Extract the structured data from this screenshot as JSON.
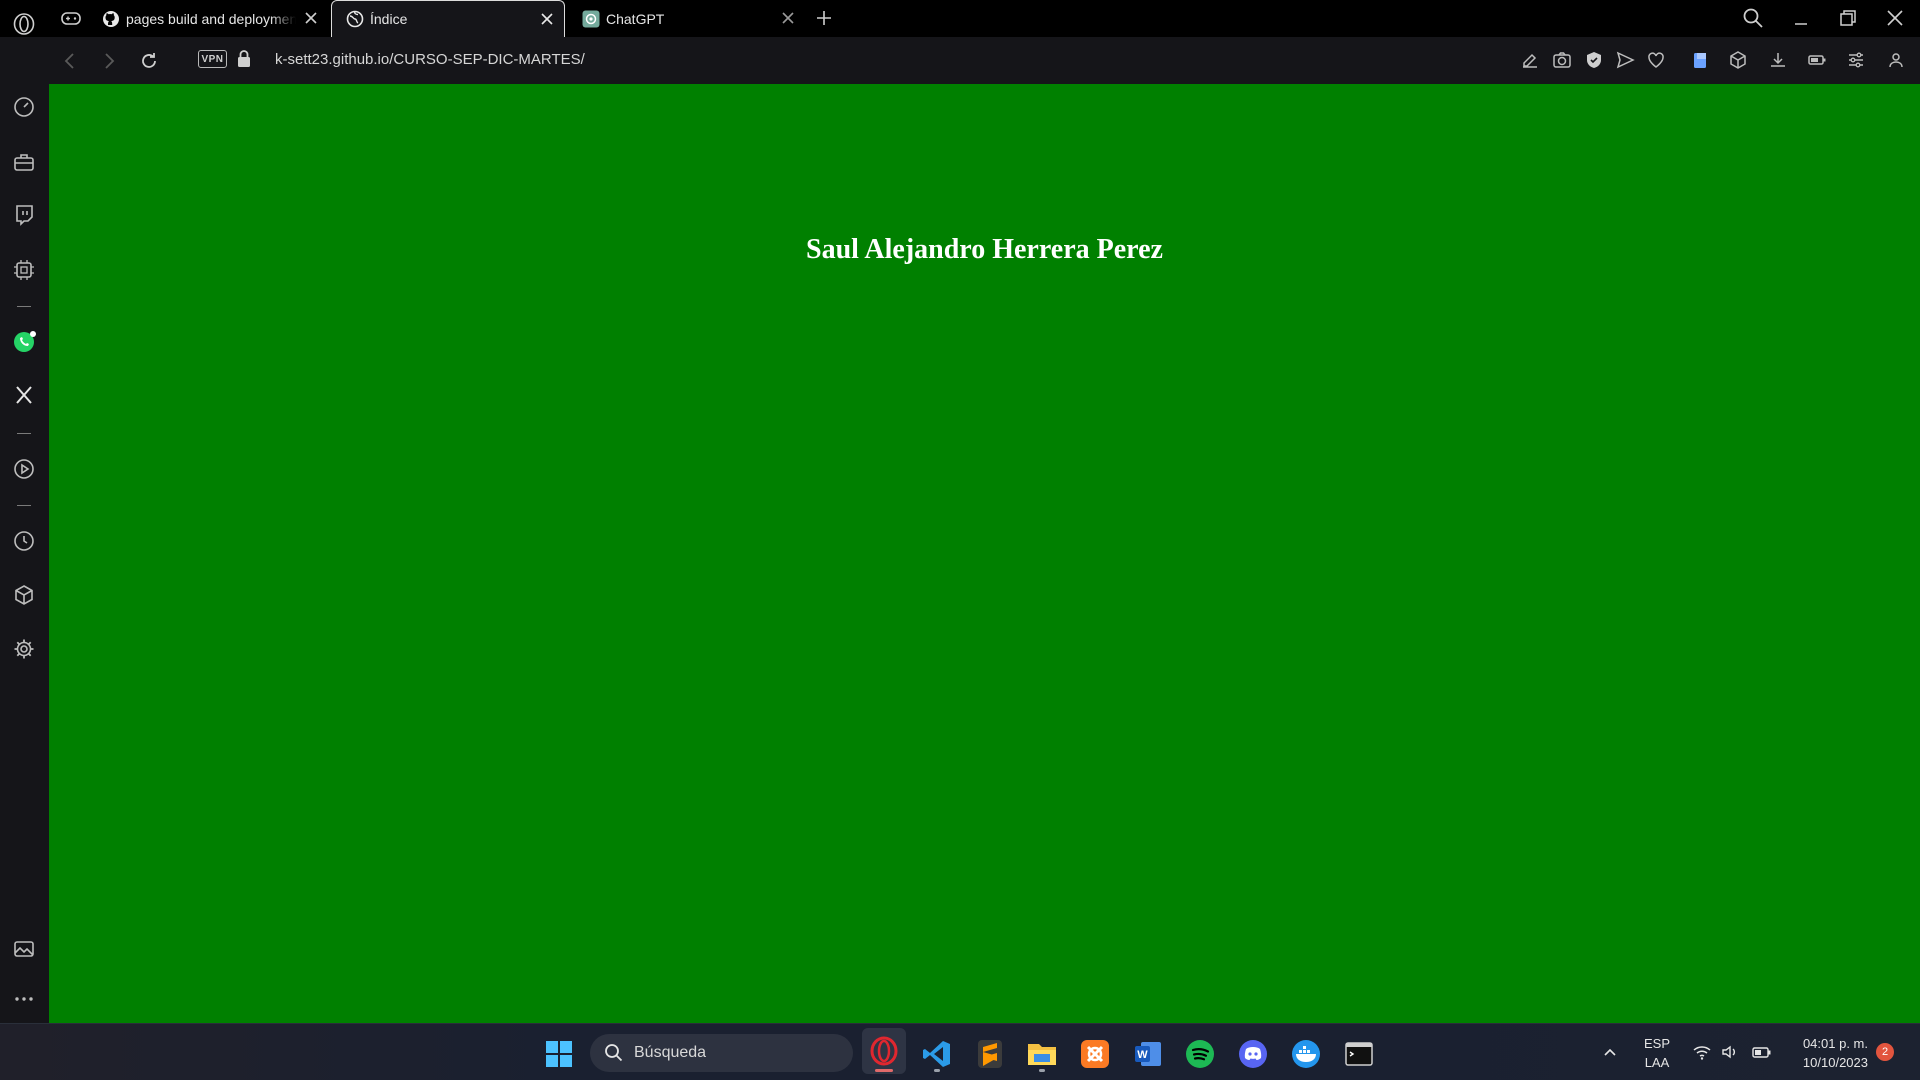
{
  "browser": {
    "tabs": [
      {
        "title": "pages build and deployment",
        "active": false
      },
      {
        "title": "Índice",
        "active": true
      },
      {
        "title": "ChatGPT",
        "active": false
      }
    ],
    "address": {
      "vpn_label": "VPN",
      "url": "k-sett23.github.io/CURSO-SEP-DIC-MARTES/"
    }
  },
  "page": {
    "heading": "Saul Alejandro Herrera Perez",
    "background_color": "#008000",
    "text_color": "#ffffff"
  },
  "sidebar": {
    "items": [
      "speed-dial-icon",
      "briefcase-icon",
      "twitch-icon",
      "ai-chip-icon",
      "whatsapp-icon",
      "x-icon",
      "player-icon",
      "history-icon",
      "extensions-icon",
      "settings-icon",
      "gallery-icon",
      "more-icon"
    ]
  },
  "taskbar": {
    "search_placeholder": "Búsqueda",
    "apps": [
      "opera",
      "vscode",
      "sublime-text",
      "file-explorer",
      "xampp",
      "word",
      "spotify",
      "discord",
      "docker",
      "terminal"
    ],
    "language_top": "ESP",
    "language_bottom": "LAA",
    "time": "04:01 p. m.",
    "date": "10/10/2023",
    "notification_count": "2"
  },
  "colors": {
    "accent_opera": "#e0272f",
    "whatsapp": "#25d366",
    "spotify": "#1db954",
    "discord": "#5865f2"
  }
}
